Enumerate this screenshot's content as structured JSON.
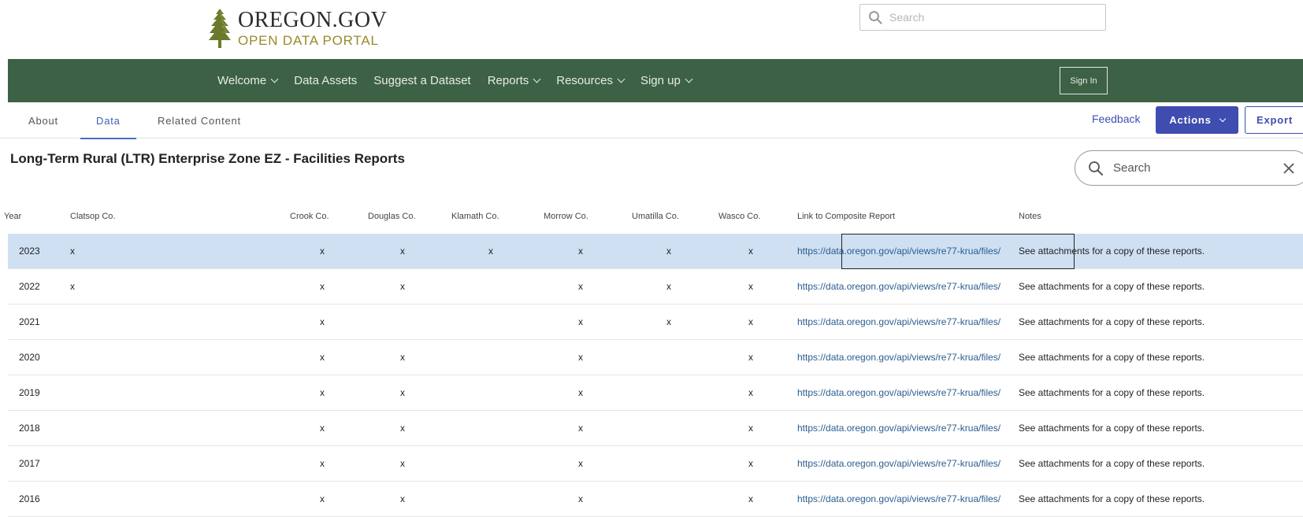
{
  "header": {
    "logo_title": "OREGON.GOV",
    "logo_subtitle": "OPEN DATA PORTAL",
    "search_placeholder": "Search"
  },
  "nav": {
    "items": [
      {
        "label": "Welcome",
        "has_dropdown": true
      },
      {
        "label": "Data Assets",
        "has_dropdown": false
      },
      {
        "label": "Suggest a Dataset",
        "has_dropdown": false
      },
      {
        "label": "Reports",
        "has_dropdown": true
      },
      {
        "label": "Resources",
        "has_dropdown": true
      },
      {
        "label": "Sign up",
        "has_dropdown": true
      }
    ],
    "sign_in": "Sign In"
  },
  "tabs": [
    {
      "label": "About",
      "active": false
    },
    {
      "label": "Data",
      "active": true
    },
    {
      "label": "Related Content",
      "active": false
    }
  ],
  "toolbar": {
    "feedback": "Feedback",
    "actions": "Actions",
    "export": "Export"
  },
  "dataset": {
    "title": "Long-Term Rural (LTR) Enterprise Zone EZ - Facilities Reports",
    "search_placeholder": "Search"
  },
  "table": {
    "columns": [
      "Year",
      "Clatsop Co.",
      "Crook Co.",
      "Douglas Co.",
      "Klamath Co.",
      "Morrow Co.",
      "Umatilla Co.",
      "Wasco Co.",
      "Link to Composite Report",
      "Notes"
    ],
    "rows": [
      {
        "year": "2023",
        "clatsop": "x",
        "crook": "x",
        "douglas": "x",
        "klamath": "x",
        "morrow": "x",
        "umatilla": "x",
        "wasco": "x",
        "link": "https://data.oregon.gov/api/views/re77-krua/files/",
        "notes": "See attachments for a copy of these reports."
      },
      {
        "year": "2022",
        "clatsop": "x",
        "crook": "x",
        "douglas": "x",
        "klamath": "",
        "morrow": "x",
        "umatilla": "x",
        "wasco": "x",
        "link": "https://data.oregon.gov/api/views/re77-krua/files/",
        "notes": "See attachments for a copy of these reports."
      },
      {
        "year": "2021",
        "clatsop": "",
        "crook": "x",
        "douglas": "",
        "klamath": "",
        "morrow": "x",
        "umatilla": "x",
        "wasco": "x",
        "link": "https://data.oregon.gov/api/views/re77-krua/files/",
        "notes": "See attachments for a copy of these reports."
      },
      {
        "year": "2020",
        "clatsop": "",
        "crook": "x",
        "douglas": "x",
        "klamath": "",
        "morrow": "x",
        "umatilla": "",
        "wasco": "x",
        "link": "https://data.oregon.gov/api/views/re77-krua/files/",
        "notes": "See attachments for a copy of these reports."
      },
      {
        "year": "2019",
        "clatsop": "",
        "crook": "x",
        "douglas": "x",
        "klamath": "",
        "morrow": "x",
        "umatilla": "",
        "wasco": "x",
        "link": "https://data.oregon.gov/api/views/re77-krua/files/",
        "notes": "See attachments for a copy of these reports."
      },
      {
        "year": "2018",
        "clatsop": "",
        "crook": "x",
        "douglas": "x",
        "klamath": "",
        "morrow": "x",
        "umatilla": "",
        "wasco": "x",
        "link": "https://data.oregon.gov/api/views/re77-krua/files/",
        "notes": "See attachments for a copy of these reports."
      },
      {
        "year": "2017",
        "clatsop": "",
        "crook": "x",
        "douglas": "x",
        "klamath": "",
        "morrow": "x",
        "umatilla": "",
        "wasco": "x",
        "link": "https://data.oregon.gov/api/views/re77-krua/files/",
        "notes": "See attachments for a copy of these reports."
      },
      {
        "year": "2016",
        "clatsop": "",
        "crook": "x",
        "douglas": "x",
        "klamath": "",
        "morrow": "x",
        "umatilla": "",
        "wasco": "x",
        "link": "https://data.oregon.gov/api/views/re77-krua/files/",
        "notes": "See attachments for a copy of these reports."
      }
    ],
    "selected_row": 0
  },
  "colors": {
    "nav_green": "#3d6145",
    "accent_blue": "#3f4cb0",
    "selected_row": "#cfe0f3",
    "link": "#2a5d8f",
    "logo_gold": "#9a8a2a"
  }
}
